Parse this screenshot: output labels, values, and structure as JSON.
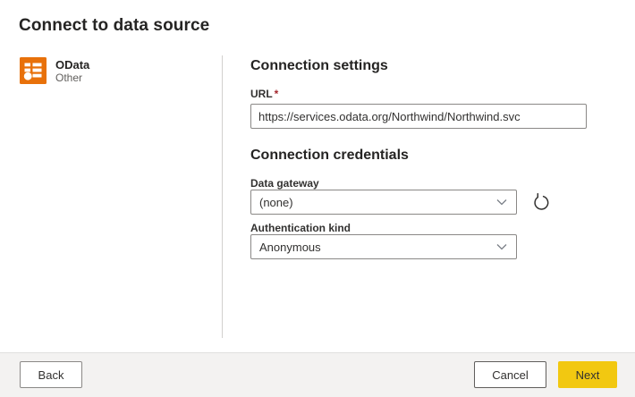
{
  "page": {
    "title": "Connect to data source"
  },
  "connector": {
    "name": "OData",
    "category": "Other",
    "icon": "odata-feed-icon",
    "icon_color": "#E8710A"
  },
  "settings": {
    "heading": "Connection settings",
    "url_label": "URL",
    "required_marker": "*",
    "url_value": "https://services.odata.org/Northwind/Northwind.svc"
  },
  "credentials": {
    "heading": "Connection credentials",
    "gateway_label": "Data gateway",
    "gateway_value": "(none)",
    "auth_label": "Authentication kind",
    "auth_value": "Anonymous"
  },
  "icons": {
    "dropdown": "chevron-down-icon",
    "refresh": "refresh-icon"
  },
  "footer": {
    "back_label": "Back",
    "cancel_label": "Cancel",
    "next_label": "Next"
  },
  "colors": {
    "accent_yellow": "#F2C811",
    "odata_orange": "#E8710A",
    "required_red": "#A4262C",
    "footer_bg": "#F3F2F1"
  }
}
